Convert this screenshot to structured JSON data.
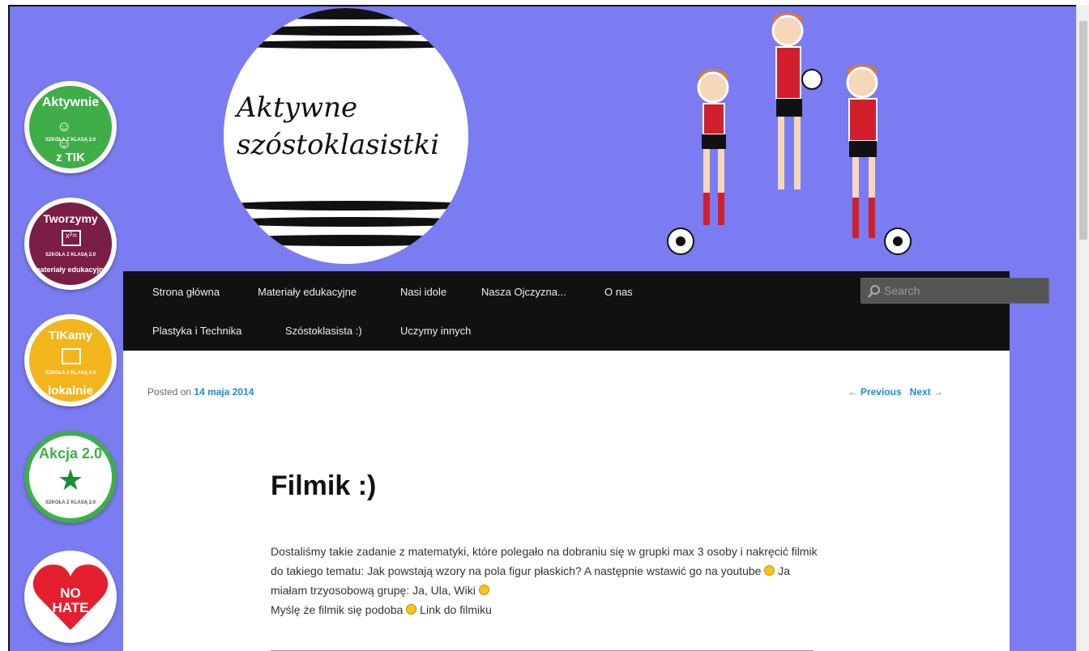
{
  "header": {
    "logo_title_line1": "Aktywne",
    "logo_title_line2": "szóstoklasistki"
  },
  "badges": [
    {
      "name": "Aktywnie z TIK",
      "top_text": "Aktywnie",
      "bottom_text": "z TIK",
      "label": "SZKOŁA Z KLASĄ 2.0",
      "color": "#3fae49"
    },
    {
      "name": "Tworzymy materiały edukacyjne",
      "top_text": "Tworzymy",
      "bottom_text": "materiały edukacyjne",
      "label": "SZKOŁA Z KLASĄ 2.0",
      "color": "#7b1d45"
    },
    {
      "name": "TIKamy lokalnie",
      "top_text": "TIKamy",
      "bottom_text": "lokalnie",
      "label": "SZKOŁA Z KLASĄ 2.0",
      "color": "#f2b51c"
    },
    {
      "name": "Akcja 2.0",
      "top_text": "Akcja 2.0",
      "bottom_text": "",
      "label": "SZKOŁA Z KLASĄ 2.0",
      "color": "#3fae49"
    },
    {
      "name": "No Hate",
      "top_text": "NO",
      "bottom_text": "HATE",
      "color": "#e5202e"
    }
  ],
  "nav": {
    "row1": [
      "Strona główna",
      "Materiały edukacyjne",
      "Nasi idole",
      "Nasza Ojczyzna...",
      "O nas"
    ],
    "row2": [
      "Plastyka i Technika",
      "Szóstoklasista :)",
      "Uczymy innych"
    ],
    "search_placeholder": "Search"
  },
  "post": {
    "posted_on": "Posted on",
    "date": "14 maja 2014",
    "prev": "← Previous",
    "next": "Next →",
    "title": "Filmik :)",
    "body_part1": "Dostaliśmy takie zadanie z matematyki, które polegało na dobraniu się w grupki max 3 osoby i nakręcić filmik do takiego tematu: Jak powstają wzory na pola figur płaskich? A następnie wstawić go na youtube ",
    "body_part2": " Ja miałam trzyosobową grupę: Ja, Ula, Wiki ",
    "body_part3": " Myślę że filmik się podoba ",
    "body_part4": " Link do filmiku"
  },
  "colors": {
    "background": "#7b7bf2",
    "nav_bg": "#111111",
    "link": "#1b8be0"
  }
}
